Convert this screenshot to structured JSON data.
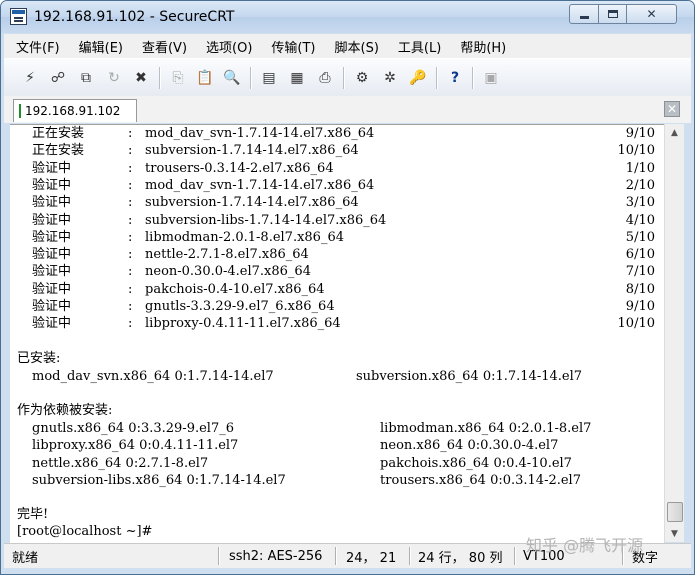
{
  "window": {
    "title": "192.168.91.102 - SecureCRT",
    "controls": {
      "minimize": "minimize",
      "maximize": "maximize",
      "close": "✕"
    }
  },
  "menu": [
    "文件(F)",
    "编辑(E)",
    "查看(V)",
    "选项(O)",
    "传输(T)",
    "脚本(S)",
    "工具(L)",
    "帮助(H)"
  ],
  "toolbar": {
    "buttons": [
      {
        "icon": "connect-icon",
        "glyph": "⚡",
        "enabled": true
      },
      {
        "icon": "quick-connect-icon",
        "glyph": "☍",
        "enabled": true
      },
      {
        "icon": "connect-tab-icon",
        "glyph": "⧉",
        "enabled": true
      },
      {
        "icon": "reconnect-icon",
        "glyph": "↻",
        "enabled": false
      },
      {
        "icon": "disconnect-icon",
        "glyph": "✖",
        "enabled": true
      },
      {
        "icon": "copy-icon",
        "glyph": "⎘",
        "enabled": false
      },
      {
        "icon": "paste-icon",
        "glyph": "📋",
        "enabled": false
      },
      {
        "icon": "find-icon",
        "glyph": "🔍",
        "enabled": true
      },
      {
        "icon": "sftp-icon",
        "glyph": "▤",
        "enabled": true
      },
      {
        "icon": "print-setup-icon",
        "glyph": "▦",
        "enabled": true
      },
      {
        "icon": "print-icon",
        "glyph": "⎙",
        "enabled": true
      },
      {
        "icon": "session-options-icon",
        "glyph": "⚙",
        "enabled": true
      },
      {
        "icon": "global-options-icon",
        "glyph": "✲",
        "enabled": true
      },
      {
        "icon": "keymap-icon",
        "glyph": "🔑",
        "enabled": true
      },
      {
        "icon": "help-icon",
        "glyph": "?",
        "enabled": true
      },
      {
        "icon": "about-icon",
        "glyph": "▣",
        "enabled": false
      }
    ]
  },
  "tab": {
    "label": "192.168.91.102",
    "close": "✕"
  },
  "terminal": {
    "progress": [
      {
        "status": "正在安装",
        "pkg": "mod_dav_svn-1.7.14-14.el7.x86_64",
        "count": "9/10"
      },
      {
        "status": "正在安装",
        "pkg": "subversion-1.7.14-14.el7.x86_64",
        "count": "10/10"
      },
      {
        "status": "验证中",
        "pkg": "trousers-0.3.14-2.el7.x86_64",
        "count": "1/10"
      },
      {
        "status": "验证中",
        "pkg": "mod_dav_svn-1.7.14-14.el7.x86_64",
        "count": "2/10"
      },
      {
        "status": "验证中",
        "pkg": "subversion-1.7.14-14.el7.x86_64",
        "count": "3/10"
      },
      {
        "status": "验证中",
        "pkg": "subversion-libs-1.7.14-14.el7.x86_64",
        "count": "4/10"
      },
      {
        "status": "验证中",
        "pkg": "libmodman-2.0.1-8.el7.x86_64",
        "count": "5/10"
      },
      {
        "status": "验证中",
        "pkg": "nettle-2.7.1-8.el7.x86_64",
        "count": "6/10"
      },
      {
        "status": "验证中",
        "pkg": "neon-0.30.0-4.el7.x86_64",
        "count": "7/10"
      },
      {
        "status": "验证中",
        "pkg": "pakchois-0.4-10.el7.x86_64",
        "count": "8/10"
      },
      {
        "status": "验证中",
        "pkg": "gnutls-3.3.29-9.el7_6.x86_64",
        "count": "9/10"
      },
      {
        "status": "验证中",
        "pkg": "libproxy-0.4.11-11.el7.x86_64",
        "count": "10/10"
      }
    ],
    "installed_header": "已安装:",
    "installed": [
      "mod_dav_svn.x86_64 0:1.7.14-14.el7",
      "subversion.x86_64 0:1.7.14-14.el7"
    ],
    "deps_header": "作为依赖被安装:",
    "deps_left": [
      "gnutls.x86_64 0:3.3.29-9.el7_6",
      "libproxy.x86_64 0:0.4.11-11.el7",
      "nettle.x86_64 0:2.7.1-8.el7",
      "subversion-libs.x86_64 0:1.7.14-14.el7"
    ],
    "deps_right": [
      "libmodman.x86_64 0:2.0.1-8.el7",
      "neon.x86_64 0:0.30.0-4.el7",
      "pakchois.x86_64 0:0.4-10.el7",
      "trousers.x86_64 0:0.3.14-2.el7"
    ],
    "complete": "完毕!",
    "prompt": "[root@localhost ~]#"
  },
  "statusbar": {
    "ready": "就绪",
    "protocol": "ssh2: AES-256",
    "cursor": "24， 21",
    "size": "24 行， 80 列",
    "terminal_type": "VT100",
    "num_lock": "数字"
  },
  "watermark": "知乎 @腾飞开源"
}
